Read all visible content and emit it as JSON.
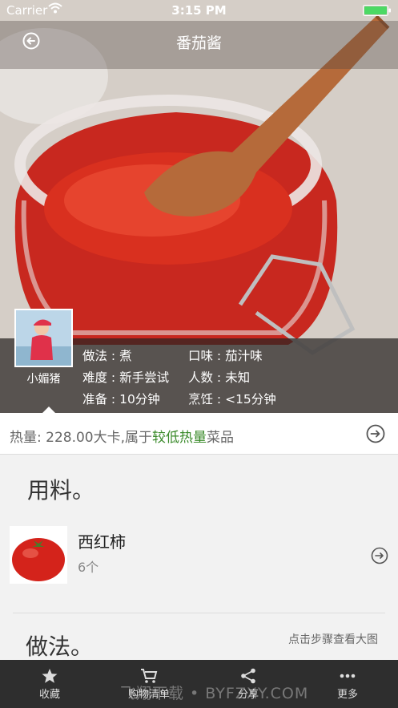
{
  "status_bar": {
    "carrier": "Carrier",
    "time": "3:15 PM"
  },
  "nav": {
    "title": "番茄酱"
  },
  "author": {
    "name": "小媚猪"
  },
  "meta": {
    "method_label": "做法 : 煮",
    "taste_label": "口味 : 茄汁味",
    "difficulty_label": "难度 : 新手尝试",
    "servings_label": "人数 : 未知",
    "prep_label": "准备 : 10分钟",
    "cook_label": "烹饪 : <15分钟"
  },
  "calories": {
    "prefix": "热量: 228.00大卡,属于",
    "highlight": "较低热量",
    "suffix": "菜品"
  },
  "ingredients": {
    "title": "用料。",
    "items": [
      {
        "name": "西红柿",
        "qty": "6个"
      }
    ]
  },
  "steps": {
    "title": "做法。",
    "hint": "点击步骤查看大图"
  },
  "tabbar": {
    "tabs": [
      {
        "label": "收藏",
        "icon": "star-icon"
      },
      {
        "label": "购物清单",
        "icon": "cart-icon"
      },
      {
        "label": "分享",
        "icon": "share-icon"
      },
      {
        "label": "更多",
        "icon": "more-icon"
      }
    ]
  },
  "watermark": "飞翔下载 • BYFZXY.COM",
  "colors": {
    "accent_green": "#3a8a2a",
    "tabbar_bg": "#2e2e2e",
    "sauce_red": "#d3241c"
  }
}
